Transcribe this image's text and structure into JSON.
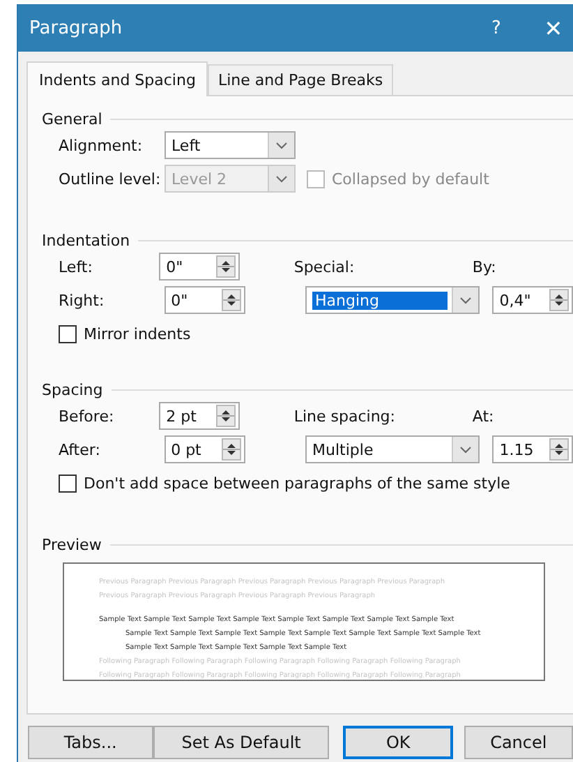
{
  "window": {
    "title": "Paragraph",
    "help": "?",
    "close": "✕"
  },
  "tabs": [
    {
      "label": "Indents and Spacing",
      "selected": true
    },
    {
      "label": "Line and Page Breaks",
      "selected": false
    }
  ],
  "general": {
    "title": "General",
    "alignment": {
      "label": "Alignment:",
      "value": "Left",
      "disabled": false
    },
    "outline_level": {
      "label": "Outline level:",
      "value": "Level 2",
      "disabled": true
    },
    "collapsed": {
      "label": "Collapsed by default",
      "checked": false,
      "disabled": true
    }
  },
  "indentation": {
    "title": "Indentation",
    "left": {
      "label": "Left:",
      "value": "0\""
    },
    "right": {
      "label": "Right:",
      "value": "0\""
    },
    "special": {
      "label": "Special:",
      "value": "Hanging",
      "selected": true
    },
    "by": {
      "label": "By:",
      "value": "0,4\""
    },
    "mirror": {
      "label": "Mirror indents",
      "checked": false
    }
  },
  "spacing": {
    "title": "Spacing",
    "before": {
      "label": "Before:",
      "value": "2 pt"
    },
    "after": {
      "label": "After:",
      "value": "0 pt"
    },
    "line_spacing": {
      "label": "Line spacing:",
      "value": "Multiple",
      "selected": false
    },
    "at": {
      "label": "At:",
      "value": "1.15"
    },
    "no_space": {
      "label": "Don't add space between paragraphs of the same style",
      "checked": false
    }
  },
  "preview": {
    "title": "Preview",
    "lines": [
      {
        "kind": "previous",
        "text": "Previous Paragraph Previous Paragraph Previous Paragraph Previous Paragraph Previous Paragraph"
      },
      {
        "kind": "previous",
        "text": "Previous Paragraph Previous Paragraph Previous Paragraph Previous Paragraph"
      },
      {
        "kind": "sample",
        "text": "Sample Text Sample Text Sample Text Sample Text Sample Text Sample Text Sample Text Sample Text"
      },
      {
        "kind": "sample-indented",
        "text": "Sample Text Sample Text Sample Text Sample Text Sample Text Sample Text Sample Text Sample Text"
      },
      {
        "kind": "sample-indented",
        "text": "Sample Text Sample Text Sample Text Sample Text Sample Text"
      },
      {
        "kind": "following",
        "text": "Following Paragraph Following Paragraph Following Paragraph Following Paragraph Following Paragraph"
      },
      {
        "kind": "following",
        "text": "Following Paragraph Following Paragraph Following Paragraph Following Paragraph Following Paragraph"
      }
    ]
  },
  "buttons": [
    {
      "label": "Tabs...",
      "default": false
    },
    {
      "label": "Set As Default",
      "default": false
    },
    {
      "label": "OK",
      "default": true
    },
    {
      "label": "Cancel",
      "default": false
    }
  ]
}
